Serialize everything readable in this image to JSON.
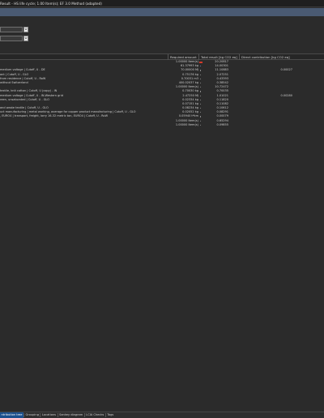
{
  "window": {
    "title": "Result - HS life cycle; 1.00 Item(s); EF 3.0 Method (adapted)"
  },
  "controls": {
    "combo1_value": "",
    "combo2_value": ""
  },
  "table": {
    "columns": [
      "",
      "Required amount",
      "Total result [kg CO2 eq]",
      "Direct contribution [kg CO2 eq]"
    ],
    "rows": [
      {
        "name": "",
        "amount": "1.00000 Item(s)",
        "marker": "red",
        "total": "20.20817",
        "direct": ""
      },
      {
        "name": "",
        "amount": "61.37993 kg",
        "marker": "blue",
        "total": "14.00301",
        "direct": ""
      },
      {
        "name": "medium voltage | Cutoff, U - DE",
        "amount": "70.00000 MJ",
        "marker": "small",
        "total": "11.10883",
        "direct": "0.00027"
      },
      {
        "name": "ant | Cutoff, U - GLO",
        "amount": "0.75176 kg",
        "marker": "small",
        "total": "2.07251",
        "direct": ""
      },
      {
        "name": "from residence | Cutoff, U - RoW",
        "amount": "0.70031 m3",
        "marker": "small",
        "total": "0.43393",
        "direct": ""
      },
      {
        "name": "without Switzerland",
        "amount": "400.02037 kg",
        "marker": "small",
        "total": "0.38542",
        "direct": ""
      },
      {
        "name": "",
        "amount": "1.00000 Item(s)",
        "marker": "small",
        "total": "10.72472",
        "direct": ""
      },
      {
        "name": "textile, knit cotton | Cutoff, U (copy) - IN",
        "amount": "0.70030 kg",
        "marker": "small",
        "total": "0.70035",
        "direct": ""
      },
      {
        "name": "medium voltage | Cutoff, U - IN-Western grid",
        "amount": "2.47250 MJ",
        "marker": "small",
        "total": "1.01021",
        "direct": "0.00280"
      },
      {
        "name": "reen, unsaturated | Cutoff, U - GLO",
        "amount": "0.02334 kg",
        "marker": "small",
        "total": "0.11820",
        "direct": ""
      },
      {
        "name": "",
        "amount": "0.07151 kg",
        "marker": "small",
        "total": "0.11082",
        "direct": ""
      },
      {
        "name": "and waste textile | Cutoff, U - GLO",
        "amount": "0.08234 kg",
        "marker": "small",
        "total": "0.10612",
        "direct": ""
      },
      {
        "name": "uct manufacturing | metal working, average for copper product manufacturing | Cutoff, U - GLO",
        "amount": "0.02052 kg",
        "marker": "small",
        "total": "0.08291",
        "direct": ""
      },
      {
        "name": ", EURO4 | transport, freight, lorry 16-32 metric ton, EURO4 | Cutoff, U - RoW",
        "amount": "0.05940 t*km",
        "marker": "small",
        "total": "0.00079",
        "direct": ""
      },
      {
        "name": "",
        "amount": "1.00000 Item(s)",
        "marker": "small",
        "total": "0.65294",
        "direct": ""
      },
      {
        "name": "",
        "amount": "1.00000 Item(s)",
        "marker": "small",
        "total": "0.09855",
        "direct": ""
      }
    ]
  },
  "bottom_tabs": [
    "ntribution tree",
    "Grouping",
    "Locations",
    "Sankey diagram",
    "LCIA Checks",
    "Tags"
  ],
  "colors": {
    "accent_bar": "#4a5a72",
    "active_tab": "#1b4f8c",
    "marker_red": "#d23a2a",
    "marker_blue": "#5b8fd6"
  }
}
